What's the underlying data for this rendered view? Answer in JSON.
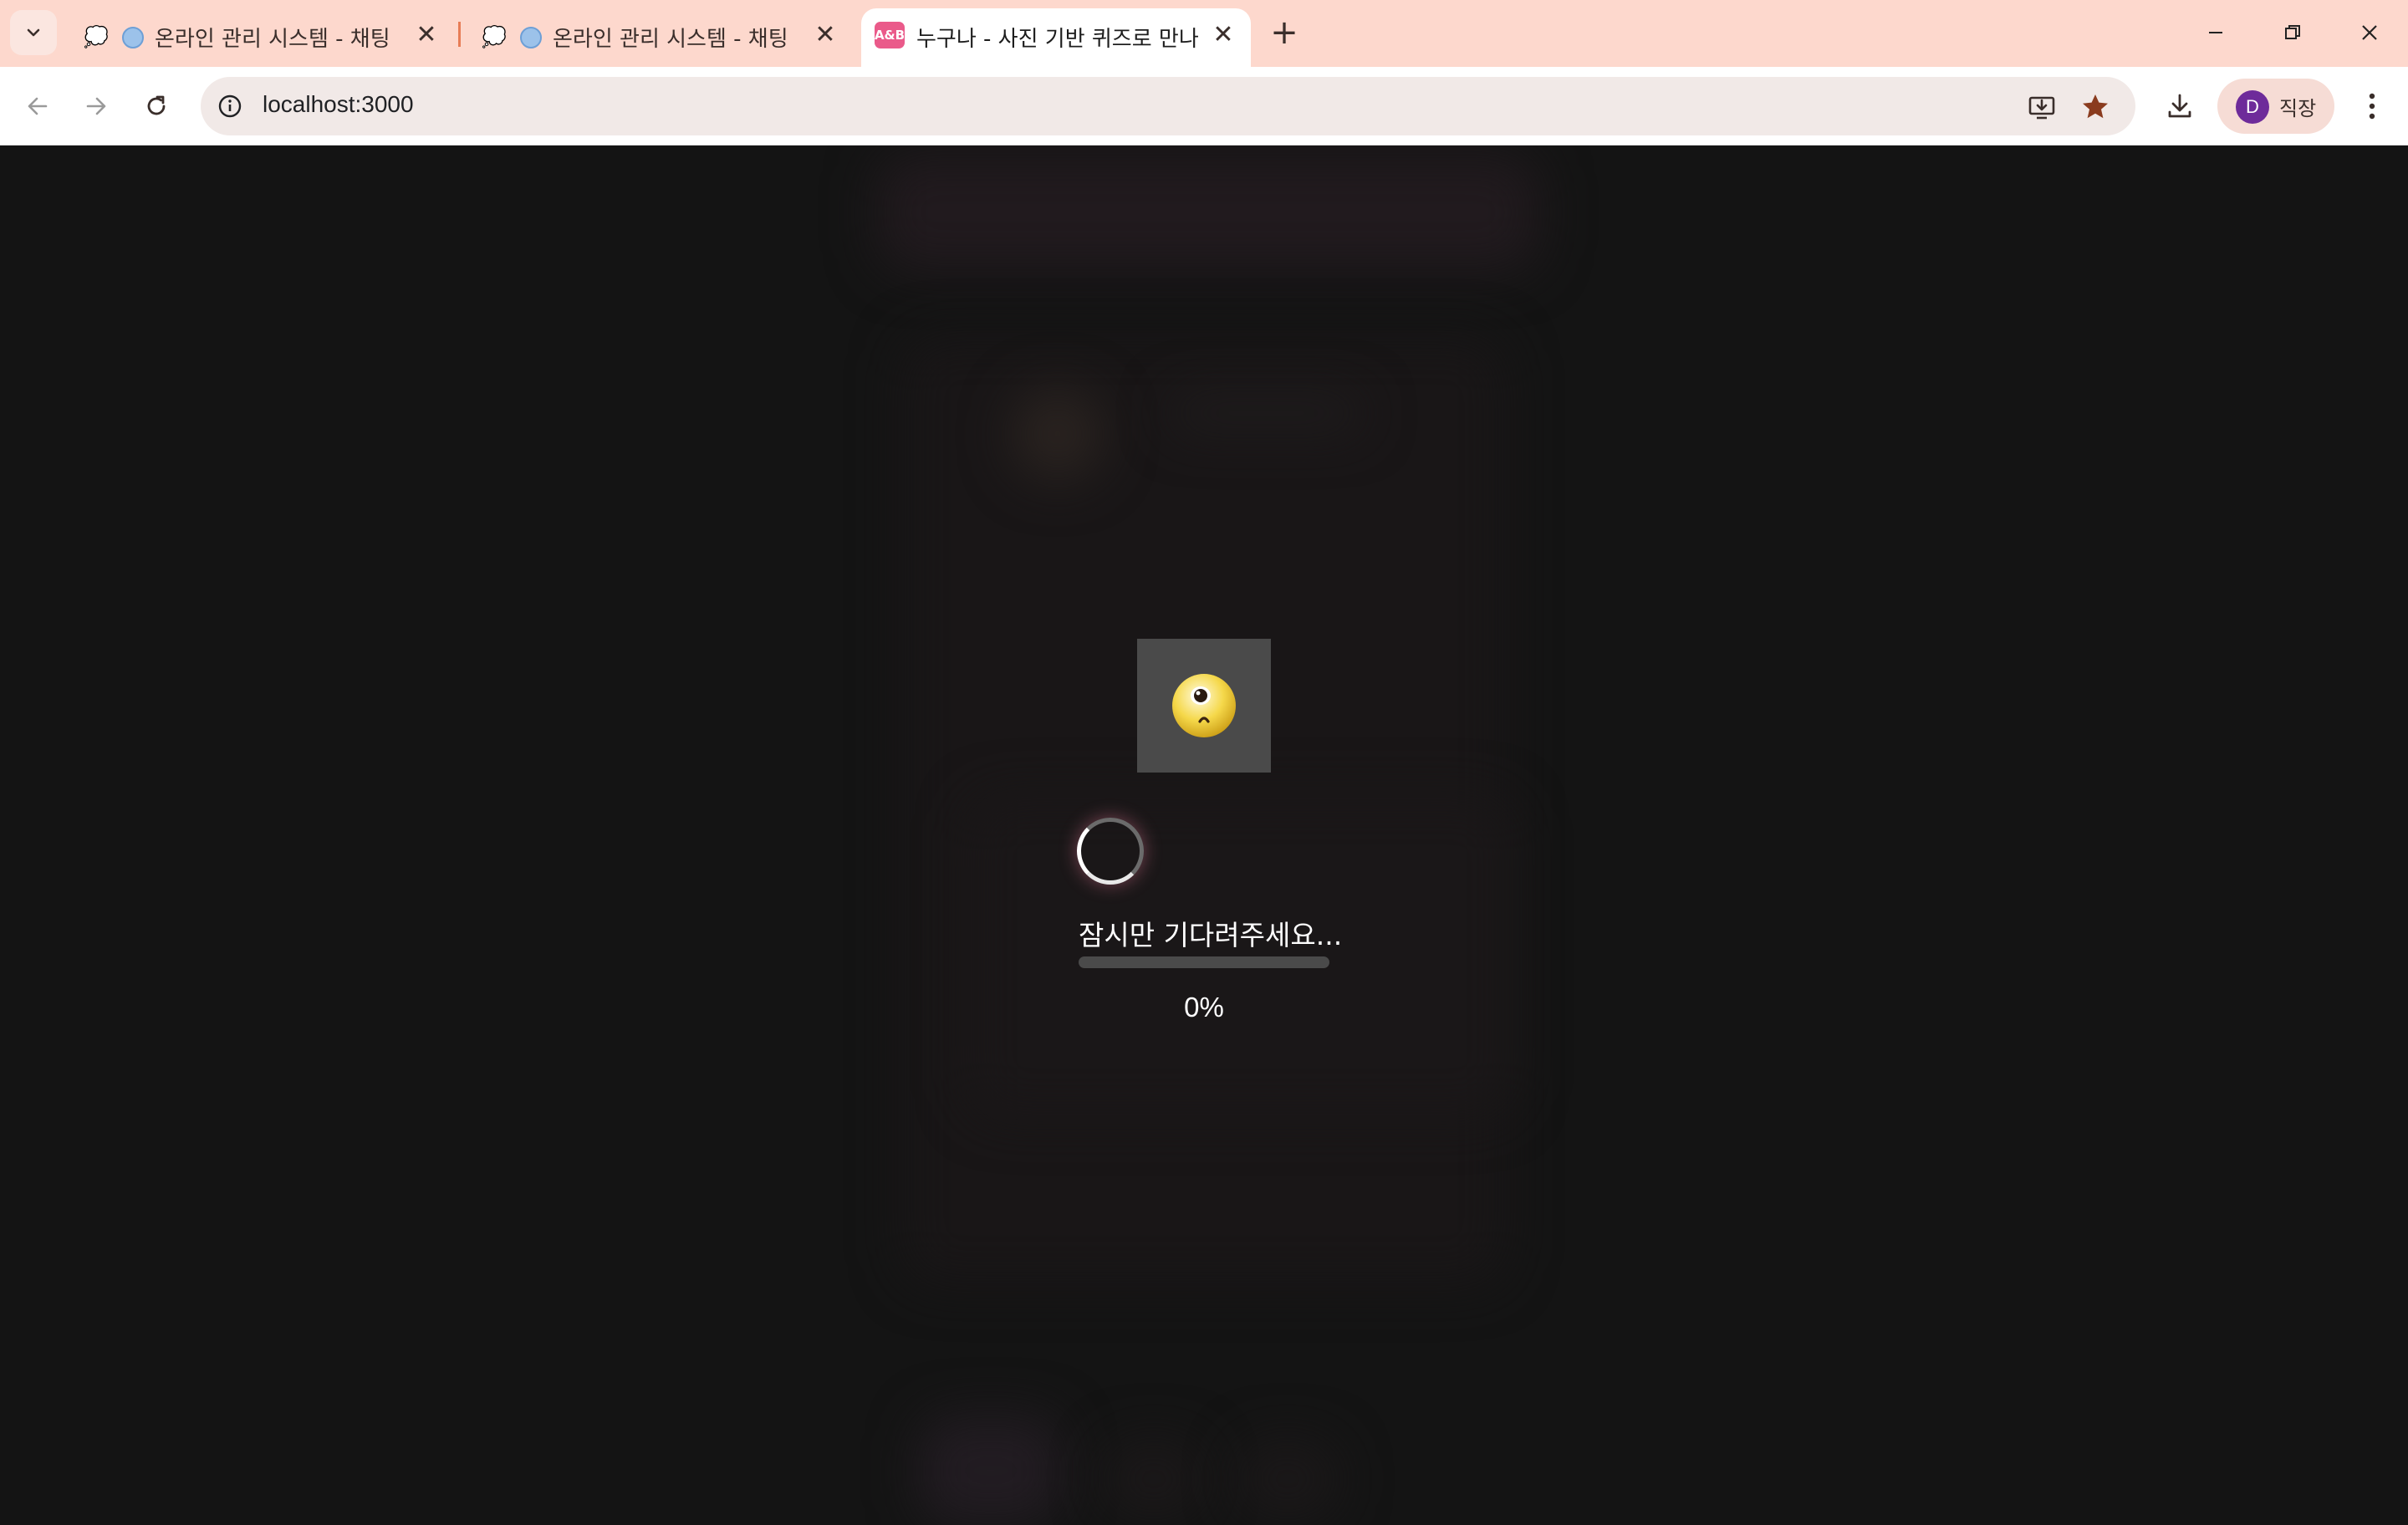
{
  "browser": {
    "tabs": [
      {
        "title": "온라인 관리 시스템 - 채팅"
      },
      {
        "title": "온라인 관리 시스템 - 채팅"
      },
      {
        "title": "누구나 - 사진 기반 퀴즈로 만나",
        "favicon_text": "A&B",
        "active": true
      }
    ],
    "url": "localhost:3000",
    "profile": {
      "initial": "D",
      "label": "직장"
    }
  },
  "loading": {
    "message": "잠시만 기다려주세요...",
    "progress": 0,
    "progress_label": "0%",
    "emoji": "🥺"
  },
  "colors": {
    "tabstrip": "#fdd8cd",
    "page_background": "#141414",
    "accent": "#e58aa8",
    "avatar": "#6e2b9a"
  }
}
